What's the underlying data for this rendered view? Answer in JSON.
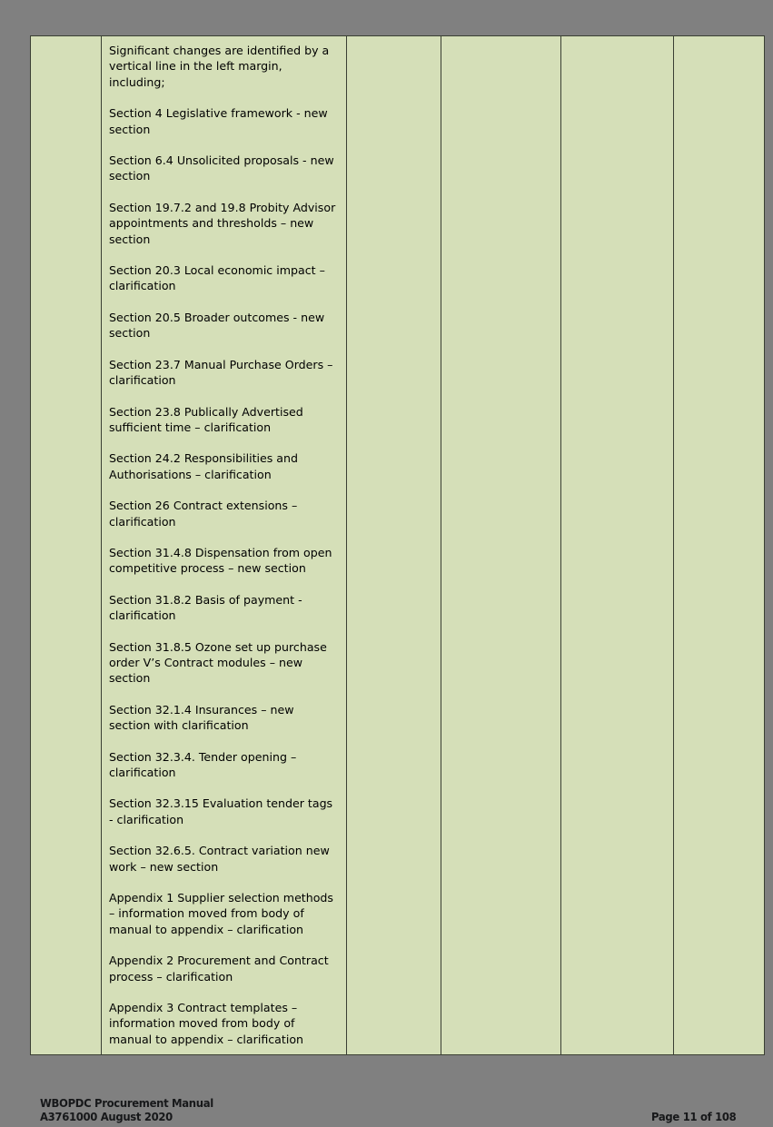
{
  "page": {
    "background_color": "#808080",
    "cell_color": "#d5dfb8",
    "border_color": "#3a3f33"
  },
  "table": {
    "columns": [
      {
        "key": "revision",
        "name": "revision-column"
      },
      {
        "key": "changes",
        "name": "changes-column"
      },
      {
        "key": "col3",
        "name": "third-column"
      },
      {
        "key": "col4",
        "name": "fourth-column"
      },
      {
        "key": "col5",
        "name": "fifth-column"
      },
      {
        "key": "col6",
        "name": "sixth-column"
      }
    ],
    "row": {
      "revision_cell": "",
      "changes_cell": {
        "paragraphs": [
          "Significant changes are identified by a vertical line in the left margin, including;",
          "Section 4 Legislative framework - new section",
          "Section 6.4 Unsolicited proposals - new section",
          "Section 19.7.2 and 19.8 Probity Advisor appointments and thresholds – new section",
          "Section 20.3 Local economic impact – clarification",
          "Section 20.5 Broader outcomes  - new section",
          "Section 23.7 Manual Purchase Orders – clarification",
          "Section 23.8 Publically Advertised sufficient time – clarification",
          "Section 24.2 Responsibilities and Authorisations – clarification",
          "Section 26 Contract extensions – clarification",
          "Section 31.4.8 Dispensation from open competitive process – new section",
          "Section 31.8.2 Basis of payment  - clarification",
          "Section 31.8.5 Ozone set up purchase order V’s Contract modules – new section",
          "Section 32.1.4 Insurances – new section with  clarification",
          "Section 32.3.4. Tender opening – clarification",
          "Section 32.3.15 Evaluation tender tags - clarification",
          "Section 32.6.5. Contract  variation new work – new section",
          "Appendix 1 Supplier selection  methods – information moved from body of manual to appendix – clarification",
          "Appendix 2 Procurement and Contract process – clarification",
          "Appendix 3 Contract templates – information moved from body of manual to appendix – clarification"
        ]
      },
      "col3_cell": "",
      "col4_cell": "",
      "col5_cell": "",
      "col6_cell": ""
    }
  },
  "footer": {
    "title": "WBOPDC Procurement Manual",
    "reference": "A3761000 August 2020",
    "page_number": "Page 11 of 108"
  }
}
